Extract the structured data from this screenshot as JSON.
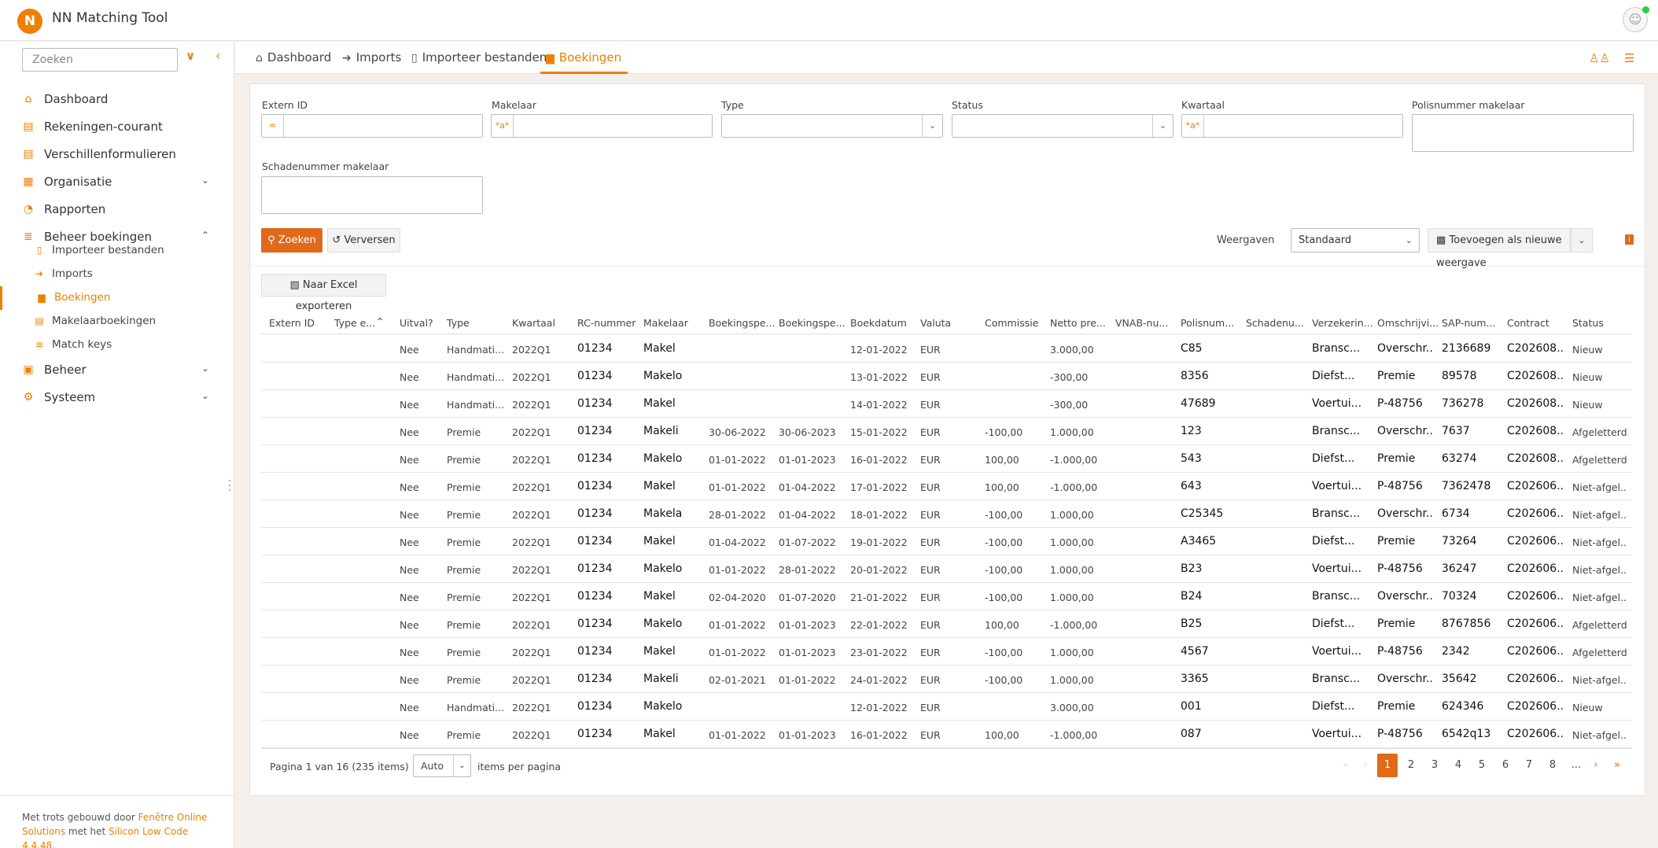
{
  "app": {
    "title": "NN Matching Tool",
    "logo_text": "N"
  },
  "sidebar": {
    "search_placeholder": "Zoeken",
    "items": [
      {
        "label": "Dashboard",
        "icon": "home-icon",
        "glyph": "⌂"
      },
      {
        "label": "Rekeningen-courant",
        "icon": "document-icon",
        "glyph": "▤"
      },
      {
        "label": "Verschillenformulieren",
        "icon": "document-icon",
        "glyph": "▤"
      },
      {
        "label": "Organisatie",
        "icon": "building-icon",
        "glyph": "▦"
      },
      {
        "label": "Rapporten",
        "icon": "pie-chart-icon",
        "glyph": "◔"
      },
      {
        "label": "Beheer boekingen",
        "icon": "database-icon",
        "glyph": "≣"
      },
      {
        "label": "Beheer",
        "icon": "folder-icon",
        "glyph": "▣"
      },
      {
        "label": "Systeem",
        "icon": "gears-icon",
        "glyph": "⚙"
      }
    ],
    "subitems": [
      {
        "label": "Importeer bestanden",
        "icon": "file-import-icon",
        "glyph": "▯"
      },
      {
        "label": "Imports",
        "icon": "import-icon",
        "glyph": "➔"
      },
      {
        "label": "Boekingen",
        "icon": "book-icon",
        "glyph": "▆"
      },
      {
        "label": "Makelaarboekingen",
        "icon": "ledger-icon",
        "glyph": "▤"
      },
      {
        "label": "Match keys",
        "icon": "lines-icon",
        "glyph": "≡"
      }
    ],
    "footer": {
      "prefix": "Met trots gebouwd door ",
      "link1": "Fenêtre Online Solutions",
      "middle": " met het ",
      "link2": "Silicon Low Code 4.4.48."
    }
  },
  "tabs": [
    {
      "label": "Dashboard",
      "icon": "home-icon",
      "glyph": "⌂"
    },
    {
      "label": "Imports",
      "icon": "import-icon",
      "glyph": "➔"
    },
    {
      "label": "Importeer bestanden",
      "icon": "file-import-icon",
      "glyph": "▯"
    },
    {
      "label": "Boekingen",
      "icon": "book-icon",
      "glyph": "▆"
    }
  ],
  "filters": {
    "extern_id": {
      "label": "Extern ID",
      "prefix": "="
    },
    "makelaar": {
      "label": "Makelaar",
      "prefix": "*a*"
    },
    "type": {
      "label": "Type"
    },
    "status": {
      "label": "Status"
    },
    "kwartaal": {
      "label": "Kwartaal",
      "prefix": "*a*"
    },
    "polisnummer": {
      "label": "Polisnummer makelaar"
    },
    "schadenummer": {
      "label": "Schadenummer makelaar"
    }
  },
  "actions": {
    "search": "Zoeken",
    "refresh": "Verversen",
    "views_label": "Weergaven",
    "views_value": "Standaard",
    "add_view": "Toevoegen als nieuwe weergave",
    "export": "Naar Excel exporteren"
  },
  "table": {
    "columns": [
      "Extern ID",
      "Type e...",
      "Uitval?",
      "Type",
      "Kwartaal",
      "RC-nummer",
      "Makelaar",
      "Boekingspe...",
      "Boekingspe...",
      "Boekdatum",
      "Valuta",
      "Commissie",
      "Netto pre...",
      "VNAB-nu...",
      "Polisnum...",
      "Schadenu...",
      "Verzekerin...",
      "Omschrijvi...",
      "SAP-num...",
      "Contract",
      "Status"
    ],
    "rows": [
      [
        "",
        "",
        "Nee",
        "Handmati...",
        "2022Q1",
        "01234",
        "Makel",
        "",
        "",
        "12-01-2022",
        "EUR",
        "",
        "3.000,00",
        "",
        "C85",
        "",
        "Bransc...",
        "Overschr..",
        "2136689",
        "C202608..",
        "Nieuw"
      ],
      [
        "",
        "",
        "Nee",
        "Handmati...",
        "2022Q1",
        "01234",
        "Makelo",
        "",
        "",
        "13-01-2022",
        "EUR",
        "",
        "-300,00",
        "",
        "8356",
        "",
        "Diefst...",
        "Premie",
        "89578",
        "C202608..",
        "Nieuw"
      ],
      [
        "",
        "",
        "Nee",
        "Handmati...",
        "2022Q1",
        "01234",
        "Makel",
        "",
        "",
        "14-01-2022",
        "EUR",
        "",
        "-300,00",
        "",
        "47689",
        "",
        "Voertui...",
        "P-48756",
        "736278",
        "C202608..",
        "Nieuw"
      ],
      [
        "",
        "",
        "Nee",
        "Premie",
        "2022Q1",
        "01234",
        "Makeli",
        "30-06-2022",
        "30-06-2023",
        "15-01-2022",
        "EUR",
        "-100,00",
        "1.000,00",
        "",
        "123",
        "",
        "Bransc...",
        "Overschr..",
        "7637",
        "C202608..",
        "Afgeletterd"
      ],
      [
        "",
        "",
        "Nee",
        "Premie",
        "2022Q1",
        "01234",
        "Makelo",
        "01-01-2022",
        "01-01-2023",
        "16-01-2022",
        "EUR",
        "100,00",
        "-1.000,00",
        "",
        "543",
        "",
        "Diefst...",
        "Premie",
        "63274",
        "C202608..",
        "Afgeletterd"
      ],
      [
        "",
        "",
        "Nee",
        "Premie",
        "2022Q1",
        "01234",
        "Makel",
        "01-01-2022",
        "01-04-2022",
        "17-01-2022",
        "EUR",
        "100,00",
        "-1.000,00",
        "",
        "643",
        "",
        "Voertui...",
        "P-48756",
        "7362478",
        "C202606..",
        "Niet-afgel..."
      ],
      [
        "",
        "",
        "Nee",
        "Premie",
        "2022Q1",
        "01234",
        "Makela",
        "28-01-2022",
        "01-04-2022",
        "18-01-2022",
        "EUR",
        "-100,00",
        "1.000,00",
        "",
        "C25345",
        "",
        "Bransc...",
        "Overschr..",
        "6734",
        "C202606..",
        "Niet-afgel..."
      ],
      [
        "",
        "",
        "Nee",
        "Premie",
        "2022Q1",
        "01234",
        "Makel",
        "01-04-2022",
        "01-07-2022",
        "19-01-2022",
        "EUR",
        "-100,00",
        "1.000,00",
        "",
        "A3465",
        "",
        "Diefst...",
        "Premie",
        "73264",
        "C202606..",
        "Niet-afgel..."
      ],
      [
        "",
        "",
        "Nee",
        "Premie",
        "2022Q1",
        "01234",
        "Makelo",
        "01-01-2022",
        "28-01-2022",
        "20-01-2022",
        "EUR",
        "-100,00",
        "1.000,00",
        "",
        "B23",
        "",
        "Voertui...",
        "P-48756",
        "36247",
        "C202606..",
        "Niet-afgel..."
      ],
      [
        "",
        "",
        "Nee",
        "Premie",
        "2022Q1",
        "01234",
        "Makel",
        "02-04-2020",
        "01-07-2020",
        "21-01-2022",
        "EUR",
        "-100,00",
        "1.000,00",
        "",
        "B24",
        "",
        "Bransc...",
        "Overschr..",
        "70324",
        "C202606..",
        "Niet-afgel..."
      ],
      [
        "",
        "",
        "Nee",
        "Premie",
        "2022Q1",
        "01234",
        "Makelo",
        "01-01-2022",
        "01-01-2023",
        "22-01-2022",
        "EUR",
        "100,00",
        "-1.000,00",
        "",
        "B25",
        "",
        "Diefst...",
        "Premie",
        "8767856",
        "C202606..",
        "Afgeletterd"
      ],
      [
        "",
        "",
        "Nee",
        "Premie",
        "2022Q1",
        "01234",
        "Makel",
        "01-01-2022",
        "01-01-2023",
        "23-01-2022",
        "EUR",
        "-100,00",
        "1.000,00",
        "",
        "4567",
        "",
        "Voertui...",
        "P-48756",
        "2342",
        "C202606..",
        "Afgeletterd"
      ],
      [
        "",
        "",
        "Nee",
        "Premie",
        "2022Q1",
        "01234",
        "Makeli",
        "02-01-2021",
        "01-01-2022",
        "24-01-2022",
        "EUR",
        "-100,00",
        "1.000,00",
        "",
        "3365",
        "",
        "Bransc...",
        "Overschr..",
        "35642",
        "C202606..",
        "Niet-afgel..."
      ],
      [
        "",
        "",
        "Nee",
        "Handmati...",
        "2022Q1",
        "01234",
        "Makelo",
        "",
        "",
        "12-01-2022",
        "EUR",
        "",
        "3.000,00",
        "",
        "001",
        "",
        "Diefst...",
        "Premie",
        "624346",
        "C202606..",
        "Nieuw"
      ],
      [
        "",
        "",
        "Nee",
        "Premie",
        "2022Q1",
        "01234",
        "Makel",
        "01-01-2022",
        "01-01-2023",
        "16-01-2022",
        "EUR",
        "100,00",
        "-1.000,00",
        "",
        "087",
        "",
        "Voertui...",
        "P-48756",
        "6542q13",
        "C202606..",
        "Niet-afgel..."
      ]
    ]
  },
  "pagination": {
    "info": "Pagina 1 van 16 (235 items)",
    "page_size": "Auto",
    "per_page_label": "items per pagina",
    "pages": [
      "1",
      "2",
      "3",
      "4",
      "5",
      "6",
      "7",
      "8",
      "..."
    ],
    "current": "1"
  },
  "colors": {
    "accent": "#ee7f00",
    "button": "#e0691a",
    "background": "#f4efeb"
  }
}
